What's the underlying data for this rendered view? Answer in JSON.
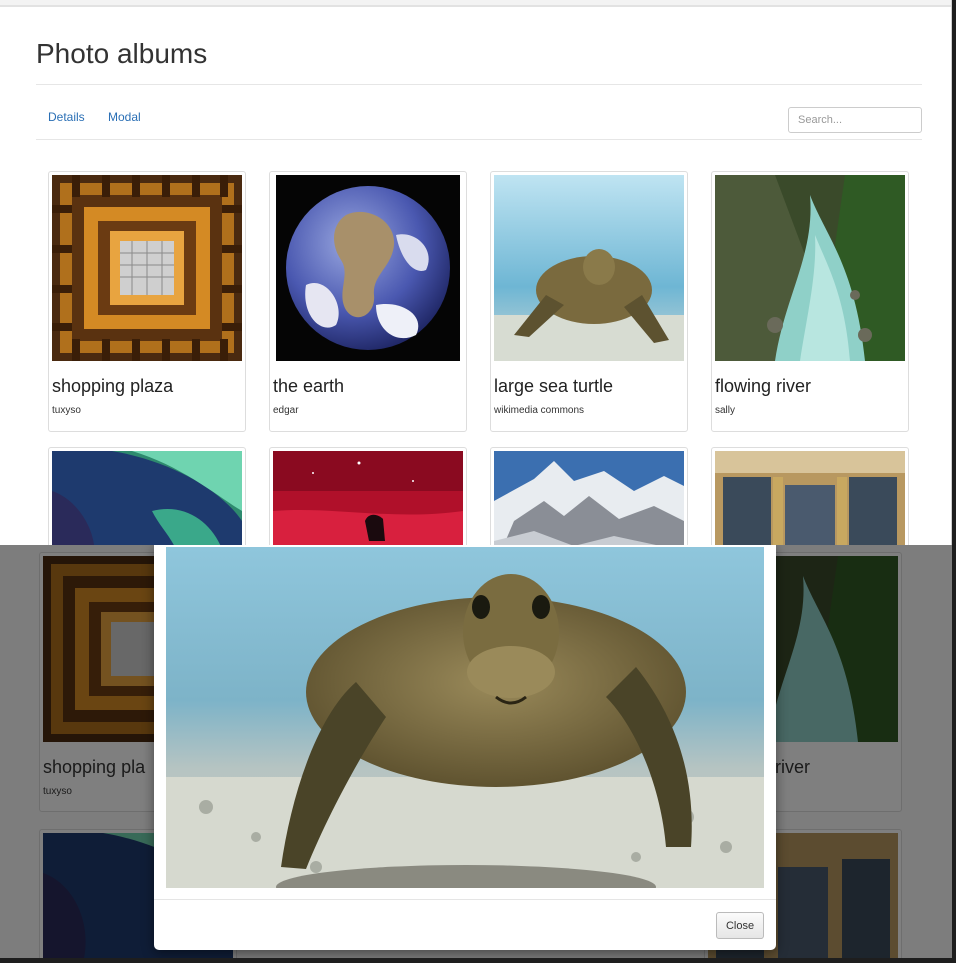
{
  "page": {
    "title": "Photo albums",
    "nav": [
      "Details",
      "Modal"
    ],
    "search_placeholder": "Search..."
  },
  "albums": [
    {
      "title": "shopping plaza",
      "author": "tuxyso",
      "image": "ornate-ceiling-photo"
    },
    {
      "title": "the earth",
      "author": "edgar",
      "image": "earth-globe-photo"
    },
    {
      "title": "large sea turtle",
      "author": "wikimedia commons",
      "image": "sea-turtle-photo"
    },
    {
      "title": "flowing river",
      "author": "sally",
      "image": "river-gorge-photo"
    },
    {
      "title": "",
      "author": "",
      "image": "green-abstract-photo"
    },
    {
      "title": "",
      "author": "",
      "image": "red-nebula-photo"
    },
    {
      "title": "",
      "author": "",
      "image": "snowy-mountain-photo"
    },
    {
      "title": "",
      "author": "",
      "image": "tapestry-room-photo"
    }
  ],
  "background_cards": [
    {
      "title": "shopping pla",
      "author": "tuxyso"
    },
    {
      "title": "river",
      "author": ""
    }
  ],
  "modal": {
    "image": "sea-turtle-photo",
    "close_label": "Close"
  },
  "colors": {
    "link": "#2a6fb5",
    "overlay": "#7d7d7d"
  }
}
